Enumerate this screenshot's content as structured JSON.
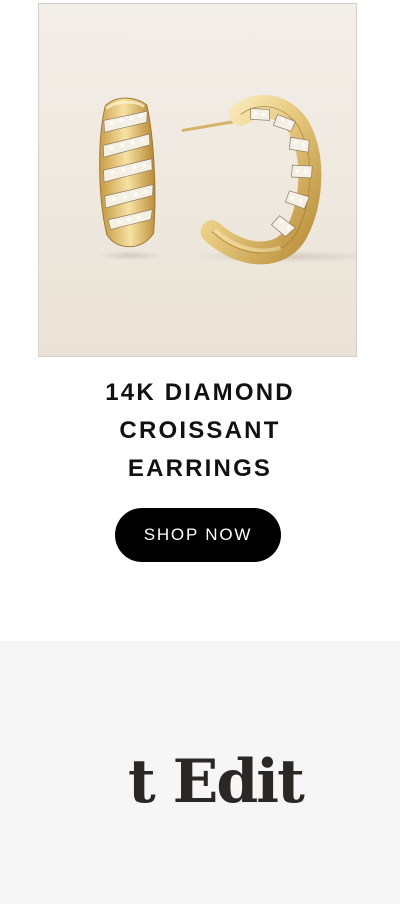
{
  "product": {
    "image_alt": "14K Diamond Croissant Earrings",
    "title": "14K DIAMOND CROISSANT EARRINGS",
    "cta_label": "SHOP NOW"
  },
  "edit_section": {
    "heading_partial": "t Edit"
  },
  "colors": {
    "image_background": "#efe9e0",
    "gold": "#e7c97e",
    "button_background": "#000000",
    "button_text": "#ffffff",
    "section_background": "#f6f6f6",
    "heading_text": "#2a2725"
  }
}
